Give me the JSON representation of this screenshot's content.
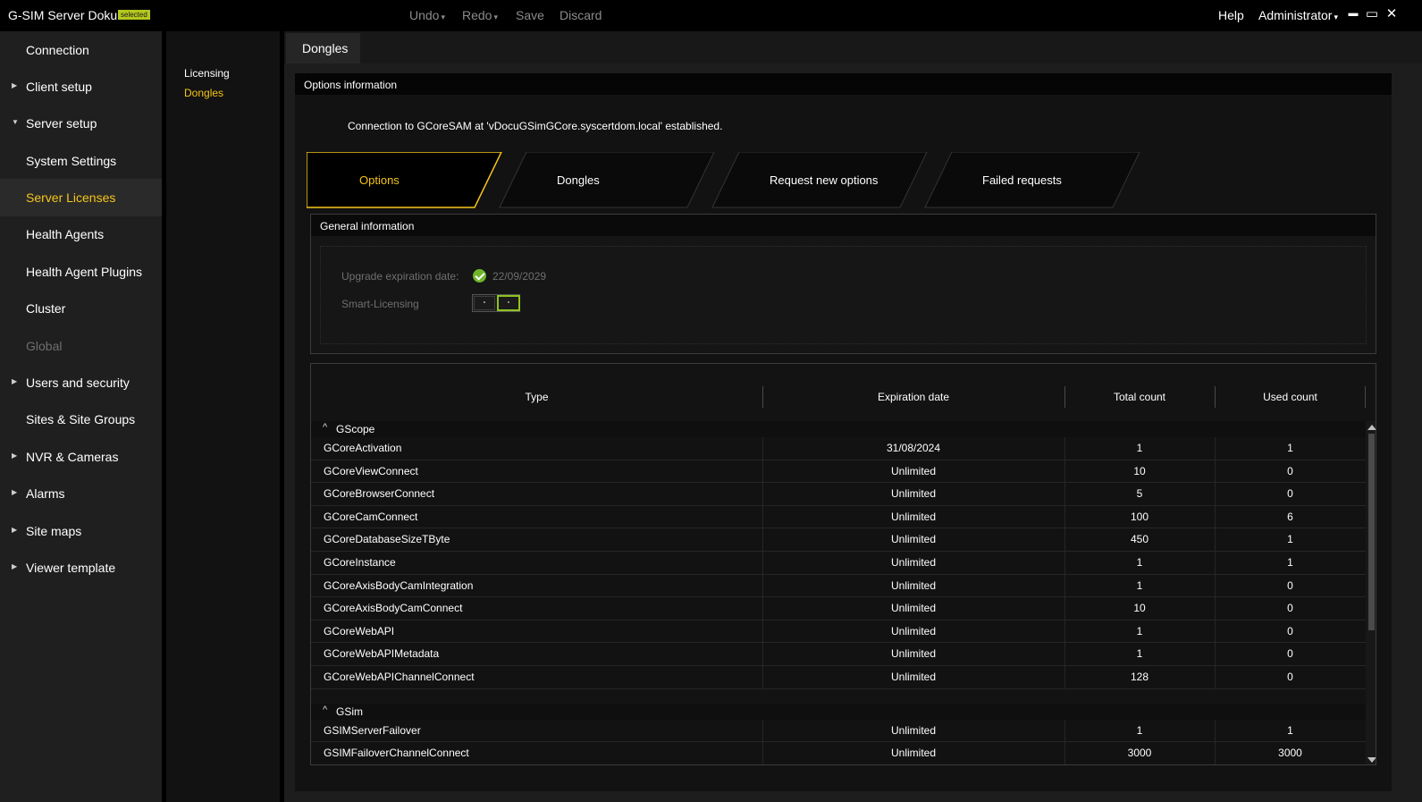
{
  "app": {
    "title": "G-SIM Server Doku",
    "badge": "selected"
  },
  "toolbar": {
    "undo": "Undo",
    "redo": "Redo",
    "save": "Save",
    "discard": "Discard",
    "caret": "▾"
  },
  "topright": {
    "help": "Help",
    "user": "Administrator",
    "caret": "▾",
    "minimize": "▬",
    "maximize": "▭",
    "close": "✕"
  },
  "sidebar": {
    "items": [
      {
        "label": "Connection",
        "arrow": ""
      },
      {
        "label": "Client setup",
        "arrow": "▶"
      },
      {
        "label": "Server setup",
        "arrow": "▼"
      },
      {
        "label": "System Settings",
        "arrow": ""
      },
      {
        "label": "Server Licenses",
        "arrow": ""
      },
      {
        "label": "Health Agents",
        "arrow": ""
      },
      {
        "label": "Health Agent Plugins",
        "arrow": ""
      },
      {
        "label": "Cluster",
        "arrow": ""
      },
      {
        "label": "Global",
        "arrow": ""
      },
      {
        "label": "Users and security",
        "arrow": "▶"
      },
      {
        "label": "Sites & Site Groups",
        "arrow": ""
      },
      {
        "label": "NVR & Cameras",
        "arrow": "▶"
      },
      {
        "label": "Alarms",
        "arrow": "▶"
      },
      {
        "label": "Site maps",
        "arrow": "▶"
      },
      {
        "label": "Viewer template",
        "arrow": "▶"
      }
    ]
  },
  "subnav": {
    "items": [
      {
        "label": "Licensing"
      },
      {
        "label": "Dongles"
      }
    ]
  },
  "page_tab": "Dongles",
  "panel": {
    "header": "Options information",
    "connection_message": "Connection to GCoreSAM at 'vDocuGSimGCore.syscertdom.local' established."
  },
  "tabs": [
    {
      "label": "Options"
    },
    {
      "label": "Dongles"
    },
    {
      "label": "Request new options"
    },
    {
      "label": "Failed requests"
    }
  ],
  "general": {
    "header": "General information",
    "upgrade_label": "Upgrade expiration date:",
    "upgrade_value": "22/09/2029",
    "smart_label": "Smart-Licensing"
  },
  "table": {
    "columns": [
      "Type",
      "Expiration date",
      "Total count",
      "Used count"
    ],
    "groups": [
      {
        "name": "GScope",
        "chevron": "^",
        "rows": [
          [
            "GCoreActivation",
            "31/08/2024",
            "1",
            "1"
          ],
          [
            "GCoreViewConnect",
            "Unlimited",
            "10",
            "0"
          ],
          [
            "GCoreBrowserConnect",
            "Unlimited",
            "5",
            "0"
          ],
          [
            "GCoreCamConnect",
            "Unlimited",
            "100",
            "6"
          ],
          [
            "GCoreDatabaseSizeTByte",
            "Unlimited",
            "450",
            "1"
          ],
          [
            "GCoreInstance",
            "Unlimited",
            "1",
            "1"
          ],
          [
            "GCoreAxisBodyCamIntegration",
            "Unlimited",
            "1",
            "0"
          ],
          [
            "GCoreAxisBodyCamConnect",
            "Unlimited",
            "10",
            "0"
          ],
          [
            "GCoreWebAPI",
            "Unlimited",
            "1",
            "0"
          ],
          [
            "GCoreWebAPIMetadata",
            "Unlimited",
            "1",
            "0"
          ],
          [
            "GCoreWebAPIChannelConnect",
            "Unlimited",
            "128",
            "0"
          ]
        ]
      },
      {
        "name": "GSim",
        "chevron": "^",
        "rows": [
          [
            "GSIMServerFailover",
            "Unlimited",
            "1",
            "1"
          ],
          [
            "GSIMFailoverChannelConnect",
            "Unlimited",
            "3000",
            "3000"
          ]
        ]
      }
    ]
  },
  "colors": {
    "accent": "#f5c518",
    "badge": "#b4c81e",
    "success": "#6fb52c",
    "toggle_on": "#8fc31f"
  }
}
